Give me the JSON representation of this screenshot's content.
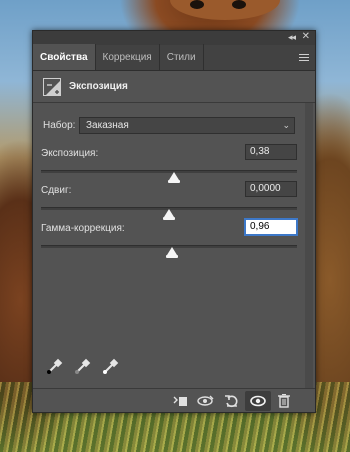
{
  "tabs": [
    {
      "label": "Свойства",
      "active": true
    },
    {
      "label": "Коррекция",
      "active": false
    },
    {
      "label": "Стили",
      "active": false
    }
  ],
  "titlebar": {
    "collapse": "◂◂",
    "close": "✕"
  },
  "header": {
    "title": "Экспозиция",
    "icon": "exposure-icon"
  },
  "preset": {
    "label": "Набор:",
    "value": "Заказная"
  },
  "sliders": [
    {
      "label": "Экспозиция:",
      "value": "0,38",
      "position": 0.52
    },
    {
      "label": "Сдвиг:",
      "value": "0,0000",
      "position": 0.5
    },
    {
      "label": "Гамма-коррекция:",
      "value": "0,96",
      "position": 0.51
    }
  ],
  "droppers": [
    "black-point-eyedropper-icon",
    "gray-point-eyedropper-icon",
    "white-point-eyedropper-icon"
  ],
  "footer": {
    "buttons": [
      "clip-to-layer-icon",
      "view-previous-state-icon",
      "reset-icon",
      "visibility-eye-icon",
      "trash-icon"
    ]
  },
  "colors": {
    "panel": "#535353",
    "tabbar": "#424242",
    "focus": "#3d78c8"
  }
}
